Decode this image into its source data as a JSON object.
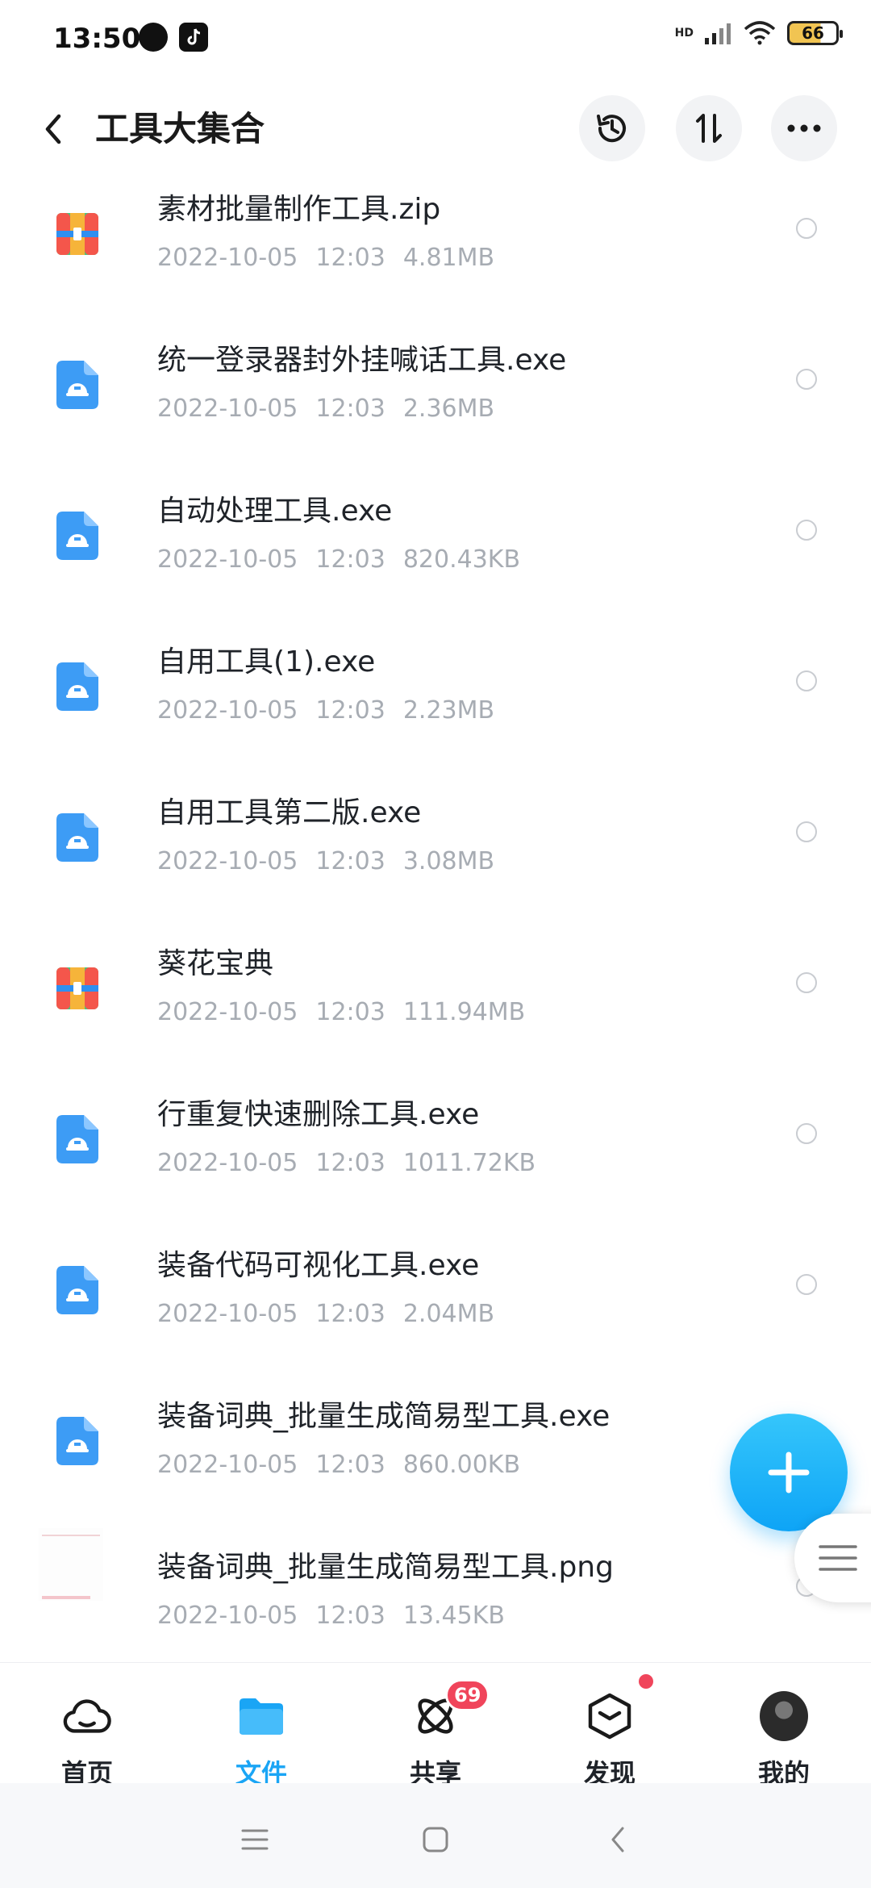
{
  "status_bar": {
    "time": "13:50",
    "battery": "66",
    "network": "HD"
  },
  "header": {
    "title": "工具大集合"
  },
  "files": [
    {
      "name": "素材批量制作工具.zip",
      "date": "2022-10-05",
      "time": "12:03",
      "size": "4.81MB",
      "type": "archive"
    },
    {
      "name": "统一登录器封外挂喊话工具.exe",
      "date": "2022-10-05",
      "time": "12:03",
      "size": "2.36MB",
      "type": "exe"
    },
    {
      "name": "自动处理工具.exe",
      "date": "2022-10-05",
      "time": "12:03",
      "size": "820.43KB",
      "type": "exe"
    },
    {
      "name": "自用工具(1).exe",
      "date": "2022-10-05",
      "time": "12:03",
      "size": "2.23MB",
      "type": "exe"
    },
    {
      "name": "自用工具第二版.exe",
      "date": "2022-10-05",
      "time": "12:03",
      "size": "3.08MB",
      "type": "exe"
    },
    {
      "name": "葵花宝典",
      "date": "2022-10-05",
      "time": "12:03",
      "size": "111.94MB",
      "type": "archive"
    },
    {
      "name": "行重复快速删除工具.exe",
      "date": "2022-10-05",
      "time": "12:03",
      "size": "1011.72KB",
      "type": "exe"
    },
    {
      "name": "装备代码可视化工具.exe",
      "date": "2022-10-05",
      "time": "12:03",
      "size": "2.04MB",
      "type": "exe"
    },
    {
      "name": "装备词典_批量生成简易型工具.exe",
      "date": "2022-10-05",
      "time": "12:03",
      "size": "860.00KB",
      "type": "exe"
    },
    {
      "name": "装备词典_批量生成简易型工具.png",
      "date": "2022-10-05",
      "time": "12:03",
      "size": "13.45KB",
      "type": "image"
    }
  ],
  "bottom_nav": [
    {
      "label": "首页",
      "icon": "cloud-icon"
    },
    {
      "label": "文件",
      "icon": "folder-icon",
      "active": true
    },
    {
      "label": "共享",
      "icon": "atom-icon",
      "badge": "69"
    },
    {
      "label": "发现",
      "icon": "cube-icon",
      "dot": true
    },
    {
      "label": "我的",
      "icon": "avatar"
    }
  ],
  "colors": {
    "accent": "#1aa5f5",
    "badge": "#f0455b",
    "exe_icon": "#3d9cf5"
  }
}
